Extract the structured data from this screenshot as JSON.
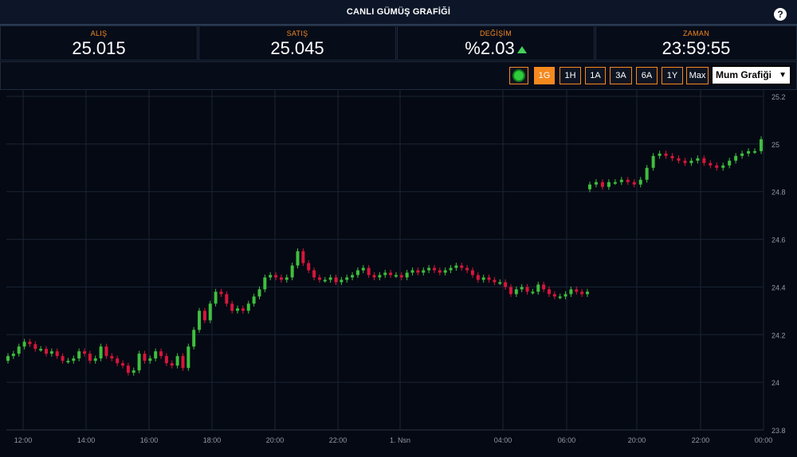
{
  "header": {
    "title": "CANLI GÜMÜŞ GRAFİĞİ",
    "help_icon": "?"
  },
  "stats": [
    {
      "label": "ALIŞ",
      "value": "25.015"
    },
    {
      "label": "SATIŞ",
      "value": "25.045"
    },
    {
      "label": "DEĞİŞİM",
      "value": "%2.03",
      "trend": "up"
    },
    {
      "label": "ZAMAN",
      "value": "23:59:55"
    }
  ],
  "toolbar": {
    "live_indicator": "green-dot-icon",
    "ranges": [
      "1G",
      "1H",
      "1A",
      "3A",
      "6A",
      "1Y",
      "Max"
    ],
    "active_range": "1G",
    "chart_type_selected": "Mum Grafiği"
  },
  "colors": {
    "up": "#3fbf3f",
    "down": "#d6163c",
    "accent": "#f5891e",
    "background": "#050913",
    "grid": "#1b2536"
  },
  "chart_data": {
    "type": "candlestick",
    "title": "",
    "xlabel": "",
    "ylabel": "",
    "ylim": [
      23.8,
      25.2
    ],
    "y_ticks": [
      "25.2",
      "25",
      "24.8",
      "24.6",
      "24.4",
      "24.2",
      "24",
      "23.8"
    ],
    "x_ticks": [
      "12:00",
      "14:00",
      "16:00",
      "18:00",
      "20:00",
      "22:00",
      "1. Nsn",
      "04:00",
      "06:00",
      "20:00",
      "22:00",
      "00:00"
    ],
    "grid": true,
    "legend": "none",
    "close_series": [
      {
        "x": "11:30",
        "close": 24.11
      },
      {
        "x": "11:40",
        "close": 24.12
      },
      {
        "x": "11:50",
        "close": 24.15
      },
      {
        "x": "12:00",
        "close": 24.17
      },
      {
        "x": "12:10",
        "close": 24.16
      },
      {
        "x": "12:20",
        "close": 24.14
      },
      {
        "x": "12:30",
        "close": 24.14
      },
      {
        "x": "12:40",
        "close": 24.12
      },
      {
        "x": "12:50",
        "close": 24.13
      },
      {
        "x": "13:00",
        "close": 24.11
      },
      {
        "x": "13:10",
        "close": 24.09
      },
      {
        "x": "13:20",
        "close": 24.09
      },
      {
        "x": "13:30",
        "close": 24.1
      },
      {
        "x": "13:40",
        "close": 24.13
      },
      {
        "x": "13:50",
        "close": 24.12
      },
      {
        "x": "14:00",
        "close": 24.09
      },
      {
        "x": "14:10",
        "close": 24.1
      },
      {
        "x": "14:20",
        "close": 24.15
      },
      {
        "x": "14:30",
        "close": 24.11
      },
      {
        "x": "14:40",
        "close": 24.1
      },
      {
        "x": "14:50",
        "close": 24.08
      },
      {
        "x": "15:00",
        "close": 24.07
      },
      {
        "x": "15:10",
        "close": 24.04
      },
      {
        "x": "15:20",
        "close": 24.05
      },
      {
        "x": "15:30",
        "close": 24.12
      },
      {
        "x": "15:40",
        "close": 24.09
      },
      {
        "x": "15:50",
        "close": 24.1
      },
      {
        "x": "16:00",
        "close": 24.13
      },
      {
        "x": "16:10",
        "close": 24.11
      },
      {
        "x": "16:20",
        "close": 24.08
      },
      {
        "x": "16:30",
        "close": 24.07
      },
      {
        "x": "16:40",
        "close": 24.11
      },
      {
        "x": "16:50",
        "close": 24.06
      },
      {
        "x": "17:00",
        "close": 24.15
      },
      {
        "x": "17:10",
        "close": 24.22
      },
      {
        "x": "17:20",
        "close": 24.3
      },
      {
        "x": "17:30",
        "close": 24.26
      },
      {
        "x": "17:40",
        "close": 24.33
      },
      {
        "x": "17:50",
        "close": 24.38
      },
      {
        "x": "18:00",
        "close": 24.37
      },
      {
        "x": "18:10",
        "close": 24.33
      },
      {
        "x": "18:20",
        "close": 24.3
      },
      {
        "x": "18:30",
        "close": 24.31
      },
      {
        "x": "18:40",
        "close": 24.3
      },
      {
        "x": "18:50",
        "close": 24.33
      },
      {
        "x": "19:00",
        "close": 24.36
      },
      {
        "x": "19:10",
        "close": 24.39
      },
      {
        "x": "19:20",
        "close": 24.44
      },
      {
        "x": "19:30",
        "close": 24.45
      },
      {
        "x": "19:40",
        "close": 24.44
      },
      {
        "x": "19:50",
        "close": 24.43
      },
      {
        "x": "20:00",
        "close": 24.44
      },
      {
        "x": "20:10",
        "close": 24.49
      },
      {
        "x": "20:20",
        "close": 24.55
      },
      {
        "x": "20:30",
        "close": 24.5
      },
      {
        "x": "20:40",
        "close": 24.47
      },
      {
        "x": "20:50",
        "close": 24.44
      },
      {
        "x": "21:00",
        "close": 24.43
      },
      {
        "x": "21:10",
        "close": 24.43
      },
      {
        "x": "21:20",
        "close": 24.44
      },
      {
        "x": "21:30",
        "close": 24.42
      },
      {
        "x": "21:40",
        "close": 24.43
      },
      {
        "x": "21:50",
        "close": 24.44
      },
      {
        "x": "22:00",
        "close": 24.45
      },
      {
        "x": "22:10",
        "close": 24.47
      },
      {
        "x": "22:20",
        "close": 24.48
      },
      {
        "x": "22:30",
        "close": 24.45
      },
      {
        "x": "22:40",
        "close": 24.44
      },
      {
        "x": "22:50",
        "close": 24.45
      },
      {
        "x": "23:00",
        "close": 24.46
      },
      {
        "x": "23:10",
        "close": 24.45
      },
      {
        "x": "23:20",
        "close": 24.45
      },
      {
        "x": "23:30",
        "close": 24.44
      },
      {
        "x": "23:40",
        "close": 24.46
      },
      {
        "x": "23:50",
        "close": 24.47
      },
      {
        "x": "00:00",
        "close": 24.46
      },
      {
        "x": "00:10",
        "close": 24.47
      },
      {
        "x": "00:20",
        "close": 24.48
      },
      {
        "x": "00:30",
        "close": 24.47
      },
      {
        "x": "00:40",
        "close": 24.46
      },
      {
        "x": "00:50",
        "close": 24.47
      },
      {
        "x": "01:00",
        "close": 24.48
      },
      {
        "x": "01:10",
        "close": 24.49
      },
      {
        "x": "01:20",
        "close": 24.48
      },
      {
        "x": "01:30",
        "close": 24.47
      },
      {
        "x": "01:40",
        "close": 24.45
      },
      {
        "x": "01:50",
        "close": 24.43
      },
      {
        "x": "02:00",
        "close": 24.44
      },
      {
        "x": "02:10",
        "close": 24.43
      },
      {
        "x": "02:20",
        "close": 24.42
      },
      {
        "x": "02:30",
        "close": 24.42
      },
      {
        "x": "02:40",
        "close": 24.4
      },
      {
        "x": "02:50",
        "close": 24.37
      },
      {
        "x": "03:00",
        "close": 24.39
      },
      {
        "x": "03:10",
        "close": 24.4
      },
      {
        "x": "03:20",
        "close": 24.38
      },
      {
        "x": "03:30",
        "close": 24.38
      },
      {
        "x": "03:40",
        "close": 24.41
      },
      {
        "x": "03:50",
        "close": 24.39
      },
      {
        "x": "04:00",
        "close": 24.37
      },
      {
        "x": "04:10",
        "close": 24.36
      },
      {
        "x": "04:20",
        "close": 24.36
      },
      {
        "x": "04:30",
        "close": 24.37
      },
      {
        "x": "04:40",
        "close": 24.39
      },
      {
        "x": "04:50",
        "close": 24.38
      },
      {
        "x": "05:00",
        "close": 24.37
      },
      {
        "x": "05:10",
        "close": 24.38
      },
      {
        "x": "19:30",
        "close": 24.83
      },
      {
        "x": "19:40",
        "close": 24.84
      },
      {
        "x": "19:50",
        "close": 24.82
      },
      {
        "x": "20:00",
        "close": 24.84
      },
      {
        "x": "20:10",
        "close": 24.84
      },
      {
        "x": "20:20",
        "close": 24.85
      },
      {
        "x": "20:30",
        "close": 24.84
      },
      {
        "x": "20:40",
        "close": 24.83
      },
      {
        "x": "20:50",
        "close": 24.85
      },
      {
        "x": "21:00",
        "close": 24.9
      },
      {
        "x": "21:10",
        "close": 24.95
      },
      {
        "x": "21:20",
        "close": 24.96
      },
      {
        "x": "21:30",
        "close": 24.95
      },
      {
        "x": "21:40",
        "close": 24.94
      },
      {
        "x": "21:50",
        "close": 24.93
      },
      {
        "x": "22:00",
        "close": 24.92
      },
      {
        "x": "22:10",
        "close": 24.93
      },
      {
        "x": "22:20",
        "close": 24.94
      },
      {
        "x": "22:30",
        "close": 24.92
      },
      {
        "x": "22:40",
        "close": 24.91
      },
      {
        "x": "22:50",
        "close": 24.9
      },
      {
        "x": "23:00",
        "close": 24.91
      },
      {
        "x": "23:10",
        "close": 24.93
      },
      {
        "x": "23:20",
        "close": 24.95
      },
      {
        "x": "23:30",
        "close": 24.96
      },
      {
        "x": "23:40",
        "close": 24.97
      },
      {
        "x": "23:50",
        "close": 24.97
      },
      {
        "x": "23:55",
        "close": 25.02
      }
    ]
  }
}
